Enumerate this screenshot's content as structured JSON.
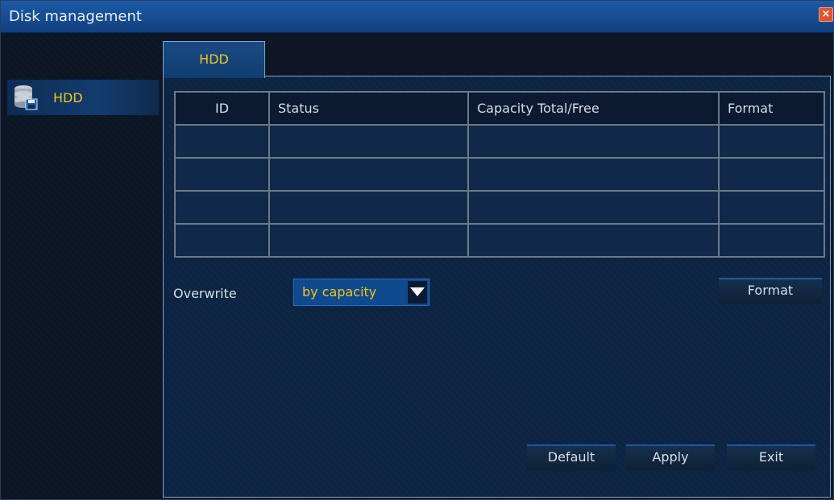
{
  "window": {
    "title": "Disk management",
    "close_icon": "close-icon"
  },
  "sidebar": {
    "items": [
      {
        "label": "HDD",
        "icon": "hdd-icon",
        "selected": true
      }
    ]
  },
  "tabs": [
    {
      "label": "HDD",
      "active": true
    }
  ],
  "table": {
    "columns": [
      "ID",
      "Status",
      "Capacity Total/Free",
      "Format"
    ],
    "rows": [
      [
        "",
        "",
        "",
        ""
      ],
      [
        "",
        "",
        "",
        ""
      ],
      [
        "",
        "",
        "",
        ""
      ],
      [
        "",
        "",
        "",
        ""
      ]
    ]
  },
  "overwrite": {
    "label": "Overwrite",
    "value": "by capacity"
  },
  "buttons": {
    "format": "Format",
    "default": "Default",
    "apply": "Apply",
    "exit": "Exit"
  },
  "colors": {
    "accent_text": "#f0c419",
    "title_bar": "#1c5aa8",
    "close": "#e2532f"
  }
}
